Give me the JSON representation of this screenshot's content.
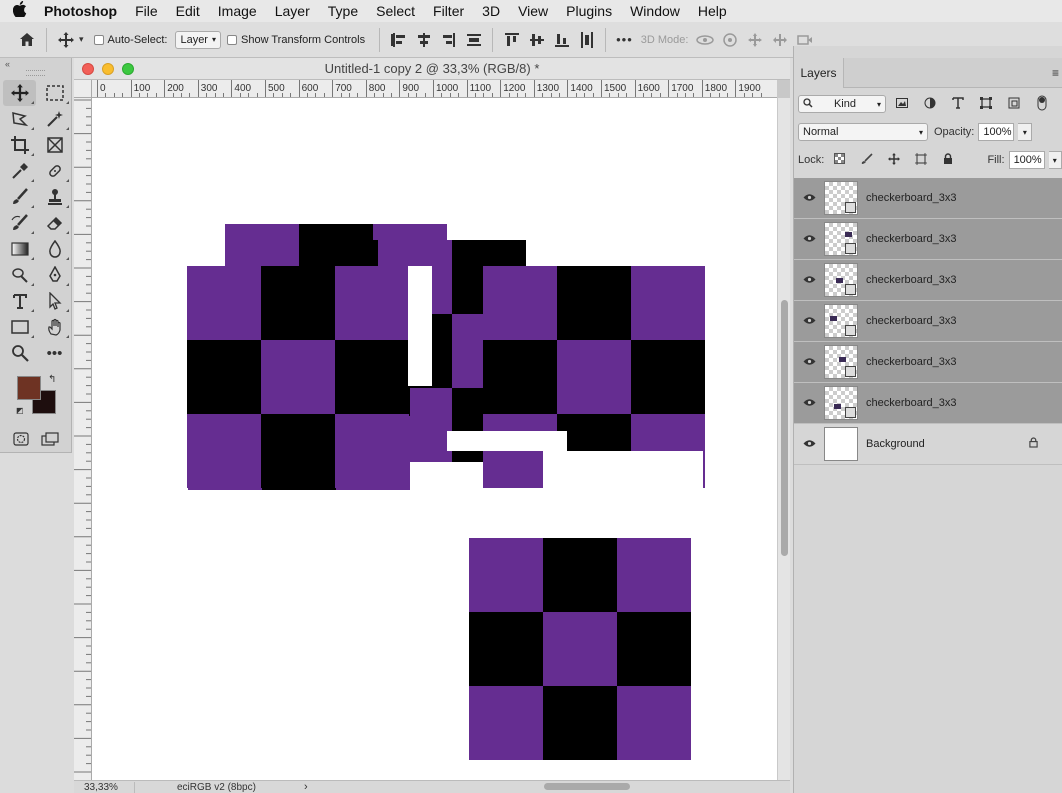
{
  "menubar": {
    "apple": "",
    "items": [
      "Photoshop",
      "File",
      "Edit",
      "Image",
      "Layer",
      "Type",
      "Select",
      "Filter",
      "3D",
      "View",
      "Plugins",
      "Window",
      "Help"
    ]
  },
  "options_bar": {
    "auto_select_label": "Auto-Select:",
    "auto_select_value": "Layer",
    "show_transform_label": "Show Transform Controls",
    "more": "•••",
    "mode_3d_label": "3D Mode:"
  },
  "tools": {
    "collapse_glyph": "«",
    "foreground_color": "#6e3323",
    "background_color": "#1e0e0e",
    "icons": [
      "move-icon",
      "marquee-icon",
      "lasso-icon",
      "magic-wand-icon",
      "crop-icon",
      "frame-icon",
      "eyedropper-icon",
      "healing-brush-icon",
      "brush-icon",
      "stamp-icon",
      "history-brush-icon",
      "eraser-icon",
      "gradient-icon",
      "blur-icon",
      "dodge-icon",
      "pen-icon",
      "type-icon",
      "path-select-icon",
      "rectangle-icon",
      "hand-icon",
      "zoom-icon",
      "more-tools-icon"
    ]
  },
  "document": {
    "title": "Untitled-1 copy 2 @ 33,3% (RGB/8) *",
    "ruler_labels": [
      "0",
      "100",
      "200",
      "300",
      "400",
      "500",
      "600",
      "700",
      "800",
      "900",
      "1000",
      "1100",
      "1200",
      "1300",
      "1400",
      "1500",
      "1600",
      "1700",
      "1800",
      "1900"
    ],
    "zoom": "33,33%",
    "color_profile": "eciRGB v2 (8bpc)",
    "status_arrow": "›",
    "purple": "#652d91",
    "black": "#000000"
  },
  "layers_panel": {
    "close_glyph": "×",
    "tab_label": "Layers",
    "menu_glyph": "≡",
    "filter_kind": "Kind",
    "blend_mode": "Normal",
    "opacity_label": "Opacity:",
    "opacity_value": "100%",
    "lock_label": "Lock:",
    "fill_label": "Fill:",
    "fill_value": "100%",
    "layers": [
      {
        "name": "checkerboard_3x3",
        "selected": true
      },
      {
        "name": "checkerboard_3x3",
        "selected": true
      },
      {
        "name": "checkerboard_3x3",
        "selected": true
      },
      {
        "name": "checkerboard_3x3",
        "selected": true
      },
      {
        "name": "checkerboard_3x3",
        "selected": true
      },
      {
        "name": "checkerboard_3x3",
        "selected": true
      },
      {
        "name": "Background",
        "selected": false
      }
    ]
  }
}
